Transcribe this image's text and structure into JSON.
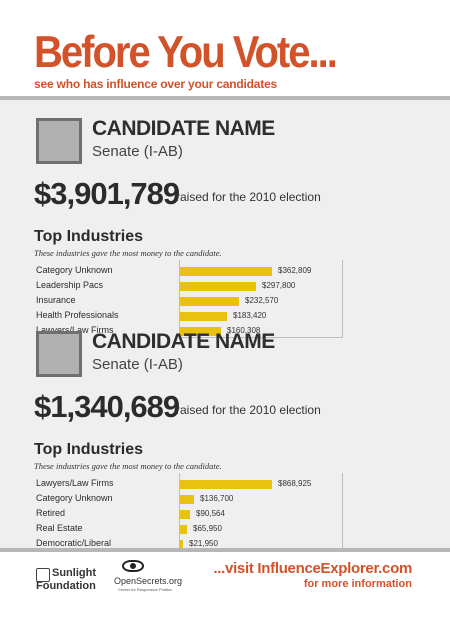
{
  "header": {
    "title": "Before You Vote...",
    "subtitle": "see who has influence over your candidates"
  },
  "candidates": [
    {
      "name": "CANDIDATE NAME",
      "office": "Senate (I-AB)",
      "amount": "$3,901,789",
      "raised_text": "raised for the 2010 election",
      "top_title": "Top Industries",
      "top_note": "These industries gave the most money to the candidate.",
      "industries": [
        {
          "label": "Category Unknown",
          "value": 362809,
          "display": "$362,809"
        },
        {
          "label": "Leadership Pacs",
          "value": 297800,
          "display": "$297,800"
        },
        {
          "label": "Insurance",
          "value": 232570,
          "display": "$232,570"
        },
        {
          "label": "Health Professionals",
          "value": 183420,
          "display": "$183,420"
        },
        {
          "label": "Lawyers/Law Firms",
          "value": 160308,
          "display": "$160,308"
        }
      ]
    },
    {
      "name": "CANDIDATE NAME",
      "office": "Senate (I-AB)",
      "amount": "$1,340,689",
      "raised_text": "raised for the 2010 election",
      "top_title": "Top Industries",
      "top_note": "These industries gave the most money to the candidate.",
      "industries": [
        {
          "label": "Lawyers/Law Firms",
          "value": 868925,
          "display": "$868,925"
        },
        {
          "label": "Category Unknown",
          "value": 136700,
          "display": "$136,700"
        },
        {
          "label": "Retired",
          "value": 90564,
          "display": "$90,564"
        },
        {
          "label": "Real Estate",
          "value": 65950,
          "display": "$65,950"
        },
        {
          "label": "Democratic/Liberal",
          "value": 21950,
          "display": "$21,950"
        }
      ]
    }
  ],
  "footer": {
    "sunlight_line1": "Sunlight",
    "sunlight_line2": "Foundation",
    "opensecrets_name": "OpenSecrets.org",
    "opensecrets_sub": "Center for Responsive Politics",
    "visit": "...visit InfluenceExplorer.com",
    "more": "for more information"
  },
  "colors": {
    "accent": "#d2522a",
    "bar": "#e8c20f",
    "panel": "#efefef"
  }
}
